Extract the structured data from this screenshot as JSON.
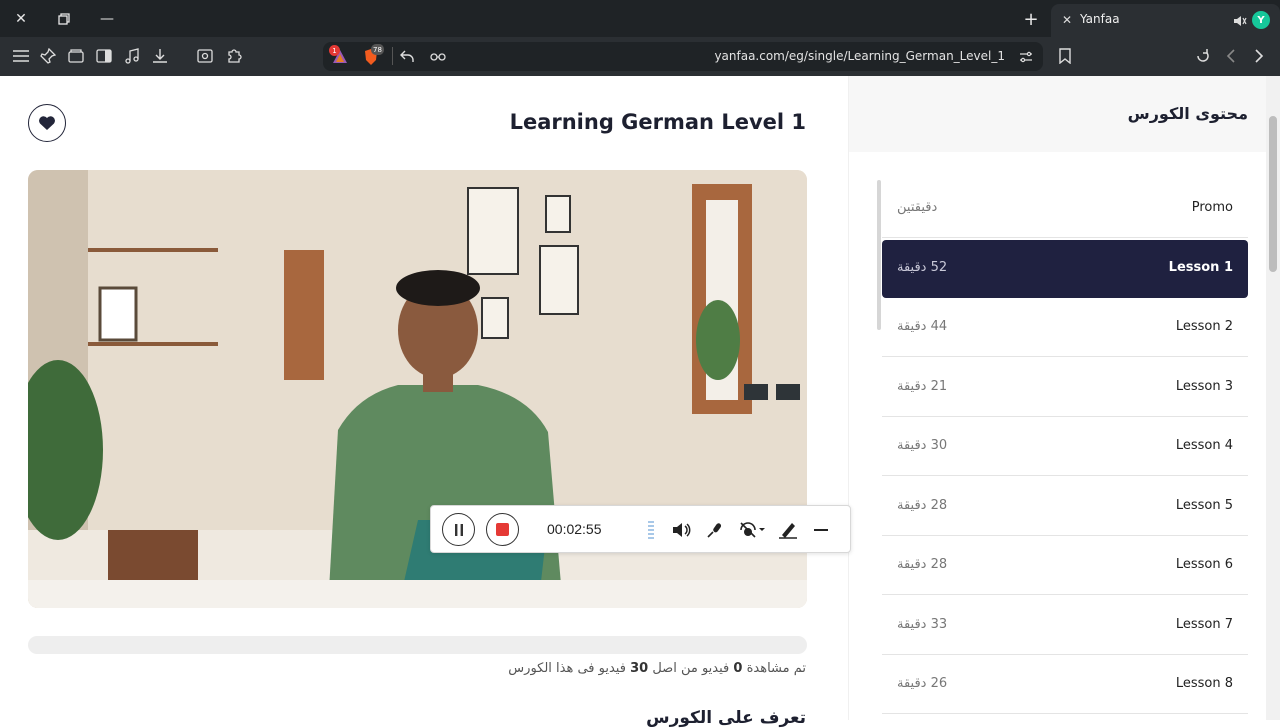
{
  "browser": {
    "tab_title": "Yanfaa",
    "tab_badge": "Y",
    "url": "yanfaa.com/eg/single/Learning_German_Level_1",
    "ext_badge_1": "1",
    "ext_badge_2": "78"
  },
  "course": {
    "title": "Learning German Level 1",
    "watched_prefix": "تم مشاهدة",
    "watched_count": "0",
    "watched_mid": "فيديو من اصل",
    "total_count": "30",
    "watched_suffix": "فيديو فى هذا الكورس",
    "progress": 0,
    "next_heading": "تعرف على الكورس"
  },
  "recorder": {
    "time": "00:02:55"
  },
  "sidebar": {
    "title": "محتوى الكورس",
    "lessons": [
      {
        "name": "Promo",
        "duration": "دقيقتين",
        "active": false
      },
      {
        "name": "Lesson 1",
        "duration": "52 دقيقة",
        "active": true
      },
      {
        "name": "Lesson 2",
        "duration": "44 دقيقة",
        "active": false
      },
      {
        "name": "Lesson 3",
        "duration": "21 دقيقة",
        "active": false
      },
      {
        "name": "Lesson 4",
        "duration": "30 دقيقة",
        "active": false
      },
      {
        "name": "Lesson 5",
        "duration": "28 دقيقة",
        "active": false
      },
      {
        "name": "Lesson 6",
        "duration": "28 دقيقة",
        "active": false
      },
      {
        "name": "Lesson 7",
        "duration": "33 دقيقة",
        "active": false
      },
      {
        "name": "Lesson 8",
        "duration": "26 دقيقة",
        "active": false
      }
    ]
  },
  "colors": {
    "active_lesson": "#1f2140",
    "record_red": "#e53935",
    "brand_badge": "#16c79a"
  }
}
